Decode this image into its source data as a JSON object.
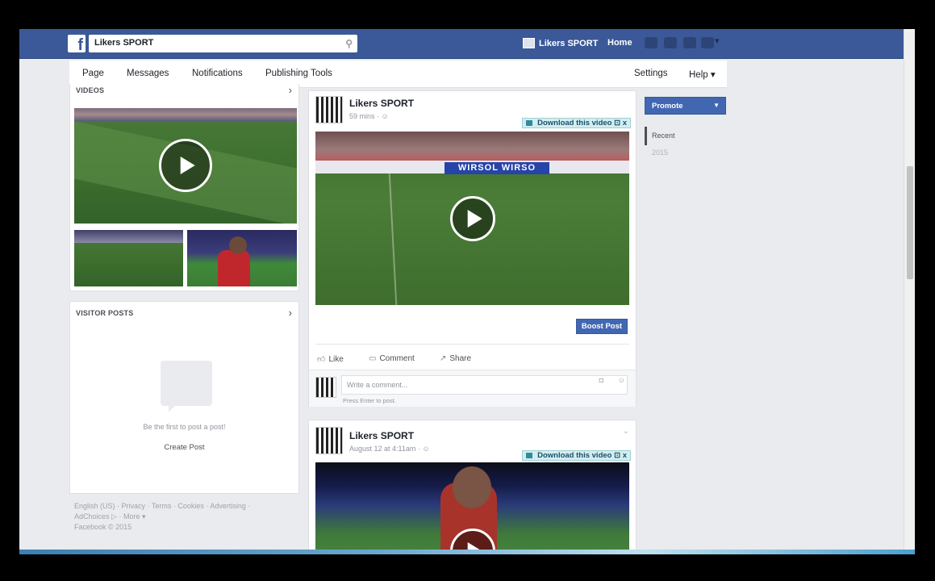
{
  "topbar": {
    "search_value": "Likers SPORT",
    "page_link": "Likers SPORT",
    "home": "Home",
    "icons": [
      "friend-requests-icon",
      "messages-icon",
      "notifications-icon",
      "privacy-shortcuts-icon",
      "account-menu-icon"
    ]
  },
  "pagenav": {
    "items": [
      "Page",
      "Messages",
      "Notifications",
      "Publishing Tools"
    ],
    "settings": "Settings",
    "help": "Help ▾"
  },
  "left": {
    "videos_title": "VIDEOS",
    "visitor_title": "VISITOR POSTS",
    "visitor_empty": "Be the first to post a post!",
    "visitor_create": "Create Post",
    "footer": "English (US) · Privacy · Terms · Cookies · Advertising · AdChoices ▷ · More ▾",
    "footer_copyright": "Facebook © 2015"
  },
  "posts": [
    {
      "name": "Likers SPORT",
      "meta": "59 mins · ☺",
      "download_label": "Download this video",
      "boost_label": "Boost Post",
      "actions": {
        "like": "Like",
        "comment": "Comment",
        "share": "Share"
      },
      "comment_placeholder": "Write a comment...",
      "comment_hint": "Press Enter to post."
    },
    {
      "name": "Likers SPORT",
      "meta": "August 12 at 4:11am · ☺",
      "download_label": "Download this video"
    }
  ],
  "right": {
    "promote": "Promote",
    "recent": "Recent",
    "year": "2015"
  },
  "colors": {
    "facebook_blue": "#3b5998",
    "button_blue": "#4267b2",
    "page_bg": "#e9ebee"
  }
}
